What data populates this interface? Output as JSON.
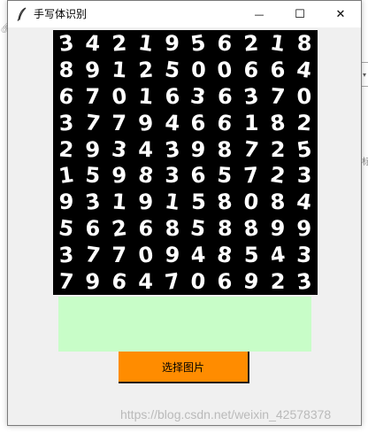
{
  "window": {
    "title": "手写体识别",
    "controls": {
      "minimize": "—",
      "maximize": "☐",
      "close": "✕"
    }
  },
  "background_window": {
    "dropdown_glyph": "▾",
    "edge_char": "标"
  },
  "digit_image": {
    "rows": [
      [
        "3",
        "4",
        "2",
        "1",
        "9",
        "5",
        "6",
        "2",
        "1",
        "8"
      ],
      [
        "8",
        "9",
        "1",
        "2",
        "5",
        "0",
        "0",
        "6",
        "6",
        "4"
      ],
      [
        "6",
        "7",
        "0",
        "1",
        "6",
        "3",
        "6",
        "3",
        "7",
        "0"
      ],
      [
        "3",
        "7",
        "7",
        "9",
        "4",
        "6",
        "6",
        "1",
        "8",
        "2"
      ],
      [
        "2",
        "9",
        "3",
        "4",
        "3",
        "9",
        "8",
        "7",
        "2",
        "5"
      ],
      [
        "1",
        "5",
        "9",
        "8",
        "3",
        "6",
        "5",
        "7",
        "2",
        "3"
      ],
      [
        "9",
        "3",
        "1",
        "9",
        "1",
        "5",
        "8",
        "0",
        "8",
        "4"
      ],
      [
        "5",
        "6",
        "2",
        "6",
        "8",
        "5",
        "8",
        "8",
        "9",
        "9"
      ],
      [
        "3",
        "7",
        "7",
        "0",
        "9",
        "4",
        "8",
        "5",
        "4",
        "3"
      ],
      [
        "7",
        "9",
        "6",
        "4",
        "7",
        "0",
        "6",
        "9",
        "2",
        "3"
      ]
    ]
  },
  "result_box": {
    "text": "",
    "color": "#c8fdc8"
  },
  "actions": {
    "choose_image_label": "选择图片",
    "button_color": "#ff8c00"
  },
  "watermark": {
    "text": "https://blog.csdn.net/weixin_42578378"
  }
}
